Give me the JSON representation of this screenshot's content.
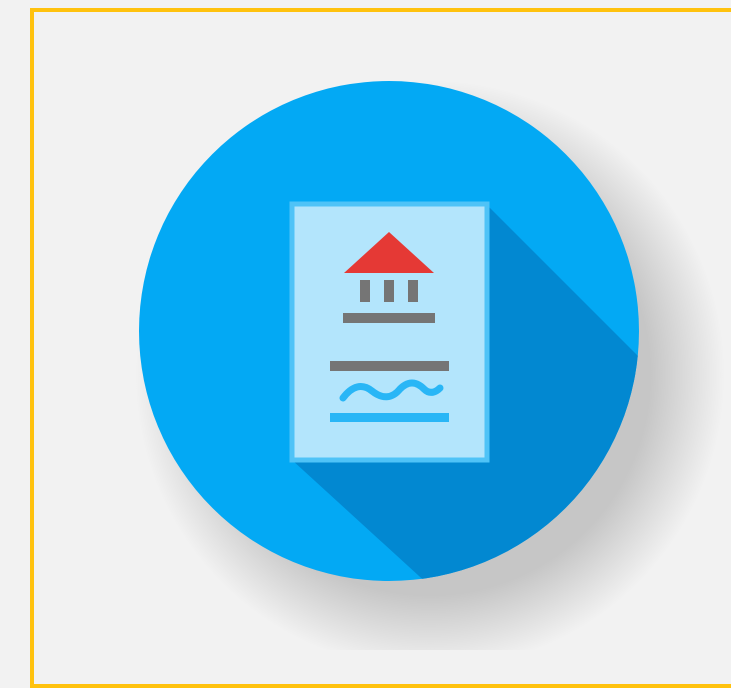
{
  "icon": {
    "name": "official-document-icon",
    "colors": {
      "frame_border": "#ffc20e",
      "background": "#f2f2f2",
      "circle": "#03a9f4",
      "long_shadow": "#0288d1",
      "page_fill": "#b3e5fc",
      "page_border": "#4fc3f7",
      "roof": "#e53935",
      "columns": "#757575",
      "signature": "#29b6f6"
    }
  }
}
